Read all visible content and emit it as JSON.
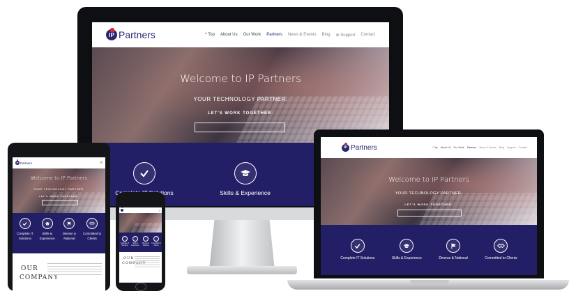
{
  "site": {
    "logo_text": "Partners",
    "logo_mark": "IP",
    "nav": [
      "^ Top",
      "About Us",
      "Our Work",
      "Partners",
      "News & Events",
      "Blog",
      "Support",
      "Contact"
    ],
    "active_nav": "Partners",
    "support_icon": "support-icon",
    "hero": {
      "title": "Welcome to IP Partners",
      "subtitle": "YOUR TECHNOLOGY PARTNER.",
      "cta": "LET'S WORK TOGETHER."
    },
    "features": [
      {
        "label": "Complete IT Solutions",
        "icon": "check-icon"
      },
      {
        "label": "Skills & Experience",
        "icon": "graduation-cap-icon"
      },
      {
        "label": "Diverse & National",
        "icon": "flag-icon"
      },
      {
        "label": "Committed to Clients",
        "icon": "handshake-icon"
      }
    ],
    "features_short": [
      {
        "line1": "Complete IT",
        "line2": "Solutions"
      },
      {
        "line1": "Skills &",
        "line2": "Experience"
      },
      {
        "line1": "Diverse &",
        "line2": "National"
      },
      {
        "line1": "Committed to",
        "line2": "Clients"
      }
    ],
    "company": {
      "heading_line1": "OUR",
      "heading_line2": "COMPANY"
    }
  },
  "colors": {
    "brand_navy": "#231f66",
    "brand_red": "#d8262f",
    "device_black": "#0e0f12"
  }
}
